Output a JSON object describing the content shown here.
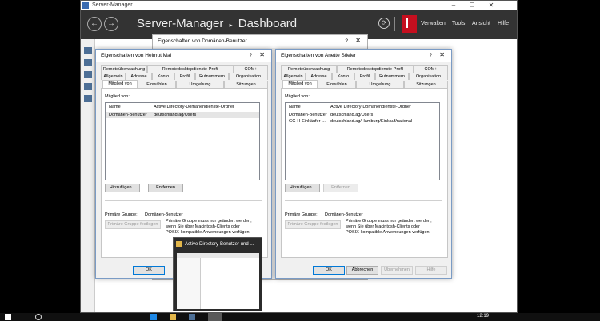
{
  "server_manager": {
    "window_title": "Server-Manager",
    "heading": "Server-Manager",
    "breadcrumb_sep": "▸",
    "page": "Dashboard",
    "menus": [
      "Verwalten",
      "Tools",
      "Ansicht",
      "Hilfe"
    ]
  },
  "back_dialog": {
    "title": "Eigenschaften von Domänen-Benutzer",
    "help": "?",
    "close": "✕"
  },
  "dialog_left": {
    "title": "Eigenschaften von Helmut Mai",
    "help": "?",
    "close": "✕",
    "tabs_row1": [
      "Remoteüberwachung",
      "Remotedesktopdienste-Profil",
      "COM+"
    ],
    "tabs_row2": [
      "Allgemein",
      "Adresse",
      "Konto",
      "Profil",
      "Rufnummern",
      "Organisation"
    ],
    "tabs_row3": [
      "Mitglied von",
      "Einwählen",
      "Umgebung",
      "Sitzungen"
    ],
    "member_of_label": "Mitglied von:",
    "columns": [
      "Name",
      "Active Directory-Domänendienste-Ordner"
    ],
    "rows": [
      [
        "Domänen-Benutzer",
        "deutschland.ag/Users"
      ]
    ],
    "add_button": "Hinzufügen...",
    "remove_button": "Entfernen",
    "primary_group_label": "Primäre Gruppe:",
    "primary_group_value": "Domänen-Benutzer",
    "set_primary_button": "Primäre Gruppe festlegen",
    "note_line1": "Primäre Gruppe muss nur geändert werden,",
    "note_line2": "wenn Sie über Macintosh-Clients oder",
    "note_line3": "POSIX-kompatible Anwendungen verfügen.",
    "ok_button": "OK"
  },
  "dialog_right": {
    "title": "Eigenschaften von Anette Stieler",
    "help": "?",
    "close": "✕",
    "tabs_row1": [
      "Remoteüberwachung",
      "Remotedesktopdienste-Profil",
      "COM+"
    ],
    "tabs_row2": [
      "Allgemein",
      "Adresse",
      "Konto",
      "Profil",
      "Rufnummern",
      "Organisation"
    ],
    "tabs_row3": [
      "Mitglied von",
      "Einwählen",
      "Umgebung",
      "Sitzungen"
    ],
    "member_of_label": "Mitglied von:",
    "columns": [
      "Name",
      "Active Directory-Domänendienste-Ordner"
    ],
    "rows": [
      [
        "Domänen-Benutzer",
        "deutschland.ag/Users"
      ],
      [
        "GG-H-Einkäufer-...",
        "deutschland.ag/Hamburg/Einkauf/national"
      ]
    ],
    "add_button": "Hinzufügen...",
    "remove_button": "Entfernen",
    "primary_group_label": "Primäre Gruppe:",
    "primary_group_value": "Domänen-Benutzer",
    "set_primary_button": "Primäre Gruppe festlegen",
    "note_line1": "Primäre Gruppe muss nur geändert werden,",
    "note_line2": "wenn Sie über Macintosh-Clients oder",
    "note_line3": "POSIX-kompatible Anwendungen verfügen.",
    "ok_button": "OK",
    "cancel_button": "Abbrechen",
    "apply_button": "Übernehmen",
    "help_button": "Hilfe"
  },
  "taskbar": {
    "thumbnail_title": "Active Directory-Benutzer und ...",
    "clock": "12:19"
  },
  "colors": {
    "flag": "#c50f1f",
    "header": "#333333",
    "accent": "#0078d7"
  }
}
